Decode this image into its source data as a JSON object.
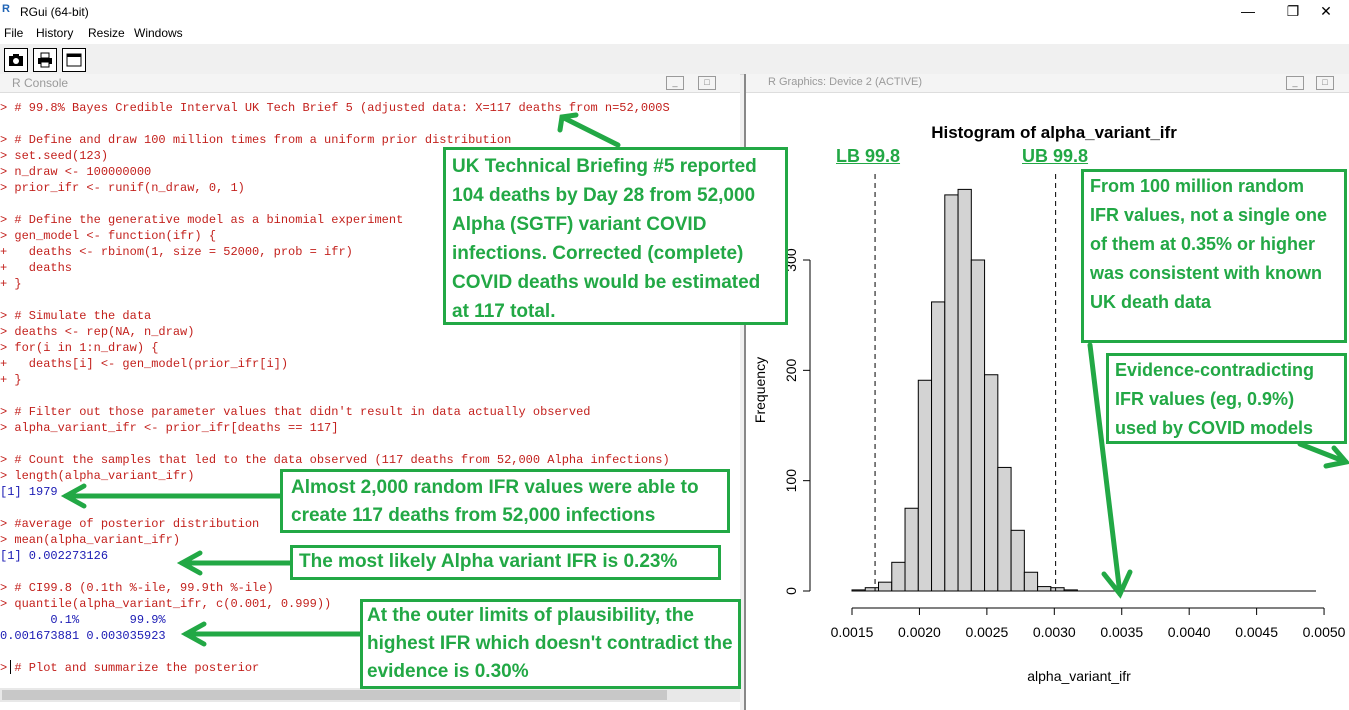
{
  "app": {
    "title": "RGui (64-bit)"
  },
  "window_controls": {
    "minimize": "—",
    "maximize": "❐",
    "close": "✕"
  },
  "menu": [
    "File",
    "History",
    "Resize",
    "Windows"
  ],
  "toolbar_icons": [
    "camera-icon",
    "print-icon",
    "window-icon"
  ],
  "console": {
    "title": "R Console",
    "lines": [
      {
        "text": "> # 99.8% Bayes Credible Interval UK Tech Brief 5 (adjusted data: X=117 deaths from n=52,000S",
        "c": "red"
      },
      {
        "text": "",
        "c": "red"
      },
      {
        "text": "> # Define and draw 100 million times from a uniform prior distribution",
        "c": "red"
      },
      {
        "text": "> set.seed(123)",
        "c": "red"
      },
      {
        "text": "> n_draw <- 100000000",
        "c": "red"
      },
      {
        "text": "> prior_ifr <- runif(n_draw, 0, 1)",
        "c": "red"
      },
      {
        "text": "",
        "c": "red"
      },
      {
        "text": "> # Define the generative model as a binomial experiment",
        "c": "red"
      },
      {
        "text": "> gen_model <- function(ifr) {",
        "c": "red"
      },
      {
        "text": "+   deaths <- rbinom(1, size = 52000, prob = ifr)",
        "c": "red"
      },
      {
        "text": "+   deaths",
        "c": "red"
      },
      {
        "text": "+ }",
        "c": "red"
      },
      {
        "text": "",
        "c": "red"
      },
      {
        "text": "> # Simulate the data",
        "c": "red"
      },
      {
        "text": "> deaths <- rep(NA, n_draw)",
        "c": "red"
      },
      {
        "text": "> for(i in 1:n_draw) {",
        "c": "red"
      },
      {
        "text": "+   deaths[i] <- gen_model(prior_ifr[i])",
        "c": "red"
      },
      {
        "text": "+ }",
        "c": "red"
      },
      {
        "text": "",
        "c": "red"
      },
      {
        "text": "> # Filter out those parameter values that didn't result in data actually observed",
        "c": "red"
      },
      {
        "text": "> alpha_variant_ifr <- prior_ifr[deaths == 117]",
        "c": "red"
      },
      {
        "text": "",
        "c": "red"
      },
      {
        "text": "> # Count the samples that led to the data observed (117 deaths from 52,000 Alpha infections)",
        "c": "red"
      },
      {
        "text": "> length(alpha_variant_ifr)",
        "c": "red"
      },
      {
        "text": "[1] 1979",
        "c": "blue"
      },
      {
        "text": "",
        "c": "red"
      },
      {
        "text": "> #average of posterior distribution",
        "c": "red"
      },
      {
        "text": "> mean(alpha_variant_ifr)",
        "c": "red"
      },
      {
        "text": "[1] 0.002273126",
        "c": "blue"
      },
      {
        "text": "",
        "c": "red"
      },
      {
        "text": "> # CI99.8 (0.1th %-ile, 99.9th %-ile)",
        "c": "red"
      },
      {
        "text": "> quantile(alpha_variant_ifr, c(0.001, 0.999))",
        "c": "red"
      },
      {
        "text": "       0.1%       99.9%",
        "c": "blue"
      },
      {
        "text": "0.001673881 0.003035923",
        "c": "blue"
      },
      {
        "text": "",
        "c": "red"
      },
      {
        "text": "> # Plot and summarize the posterior",
        "c": "red"
      }
    ]
  },
  "graphics": {
    "title": "R Graphics: Device 2 (ACTIVE)"
  },
  "chart_data": {
    "type": "bar",
    "title": "Histogram of alpha_variant_ifr",
    "xlabel": "alpha_variant_ifr",
    "ylabel": "Frequency",
    "xlim": [
      0.0015,
      0.005
    ],
    "ylim": [
      0,
      300
    ],
    "x_ticks": [
      "0.0015",
      "0.0020",
      "0.0025",
      "0.0030",
      "0.0035",
      "0.0040",
      "0.0045",
      "0.0050"
    ],
    "y_ticks": [
      "0",
      "100",
      "200",
      "300"
    ],
    "bin_width": 0.0001,
    "bins": [
      {
        "x0": 0.0015,
        "x1": 0.0016,
        "count": 1
      },
      {
        "x0": 0.0016,
        "x1": 0.0017,
        "count": 3
      },
      {
        "x0": 0.0017,
        "x1": 0.0018,
        "count": 8
      },
      {
        "x0": 0.0018,
        "x1": 0.0019,
        "count": 26
      },
      {
        "x0": 0.0019,
        "x1": 0.002,
        "count": 75
      },
      {
        "x0": 0.002,
        "x1": 0.0021,
        "count": 191
      },
      {
        "x0": 0.0021,
        "x1": 0.0022,
        "count": 262
      },
      {
        "x0": 0.0022,
        "x1": 0.0023,
        "count": 359
      },
      {
        "x0": 0.0023,
        "x1": 0.0024,
        "count": 364
      },
      {
        "x0": 0.0024,
        "x1": 0.0025,
        "count": 300
      },
      {
        "x0": 0.0025,
        "x1": 0.0026,
        "count": 196
      },
      {
        "x0": 0.0026,
        "x1": 0.0027,
        "count": 112
      },
      {
        "x0": 0.0027,
        "x1": 0.0028,
        "count": 55
      },
      {
        "x0": 0.0028,
        "x1": 0.0029,
        "count": 17
      },
      {
        "x0": 0.0029,
        "x1": 0.003,
        "count": 4
      },
      {
        "x0": 0.003,
        "x1": 0.0031,
        "count": 3
      },
      {
        "x0": 0.0031,
        "x1": 0.0032,
        "count": 1
      }
    ],
    "reference_lines": [
      {
        "label": "LB 99.8",
        "x": 0.001673881
      },
      {
        "label": "UB 99.8",
        "x": 0.003035923
      }
    ]
  },
  "annotations": {
    "brief": "UK Technical Briefing #5 reported 104 deaths by Day 28 from 52,000 Alpha (SGTF) variant COVID infections. Corrected (complete) COVID deaths would be estimated at 117 total.",
    "count": "Almost 2,000 random IFR values were able to create 117 deaths from 52,000 infections",
    "mean": "The most likely Alpha variant IFR is 0.23%",
    "ci": "At the outer limits of plausibility, the highest IFR which doesn't contradict the evidence is 0.30%",
    "random": "From 100 million random IFR values, not a single one of them at 0.35% or higher was consistent with known UK death data",
    "contradict": "Evidence-contradicting IFR values (eg, 0.9%) used by COVID models"
  },
  "colors": {
    "annotation_green": "#22a845",
    "code_red": "#c3211d",
    "output_blue": "#1a1ab4",
    "bar_fill": "#d3d3d3"
  }
}
